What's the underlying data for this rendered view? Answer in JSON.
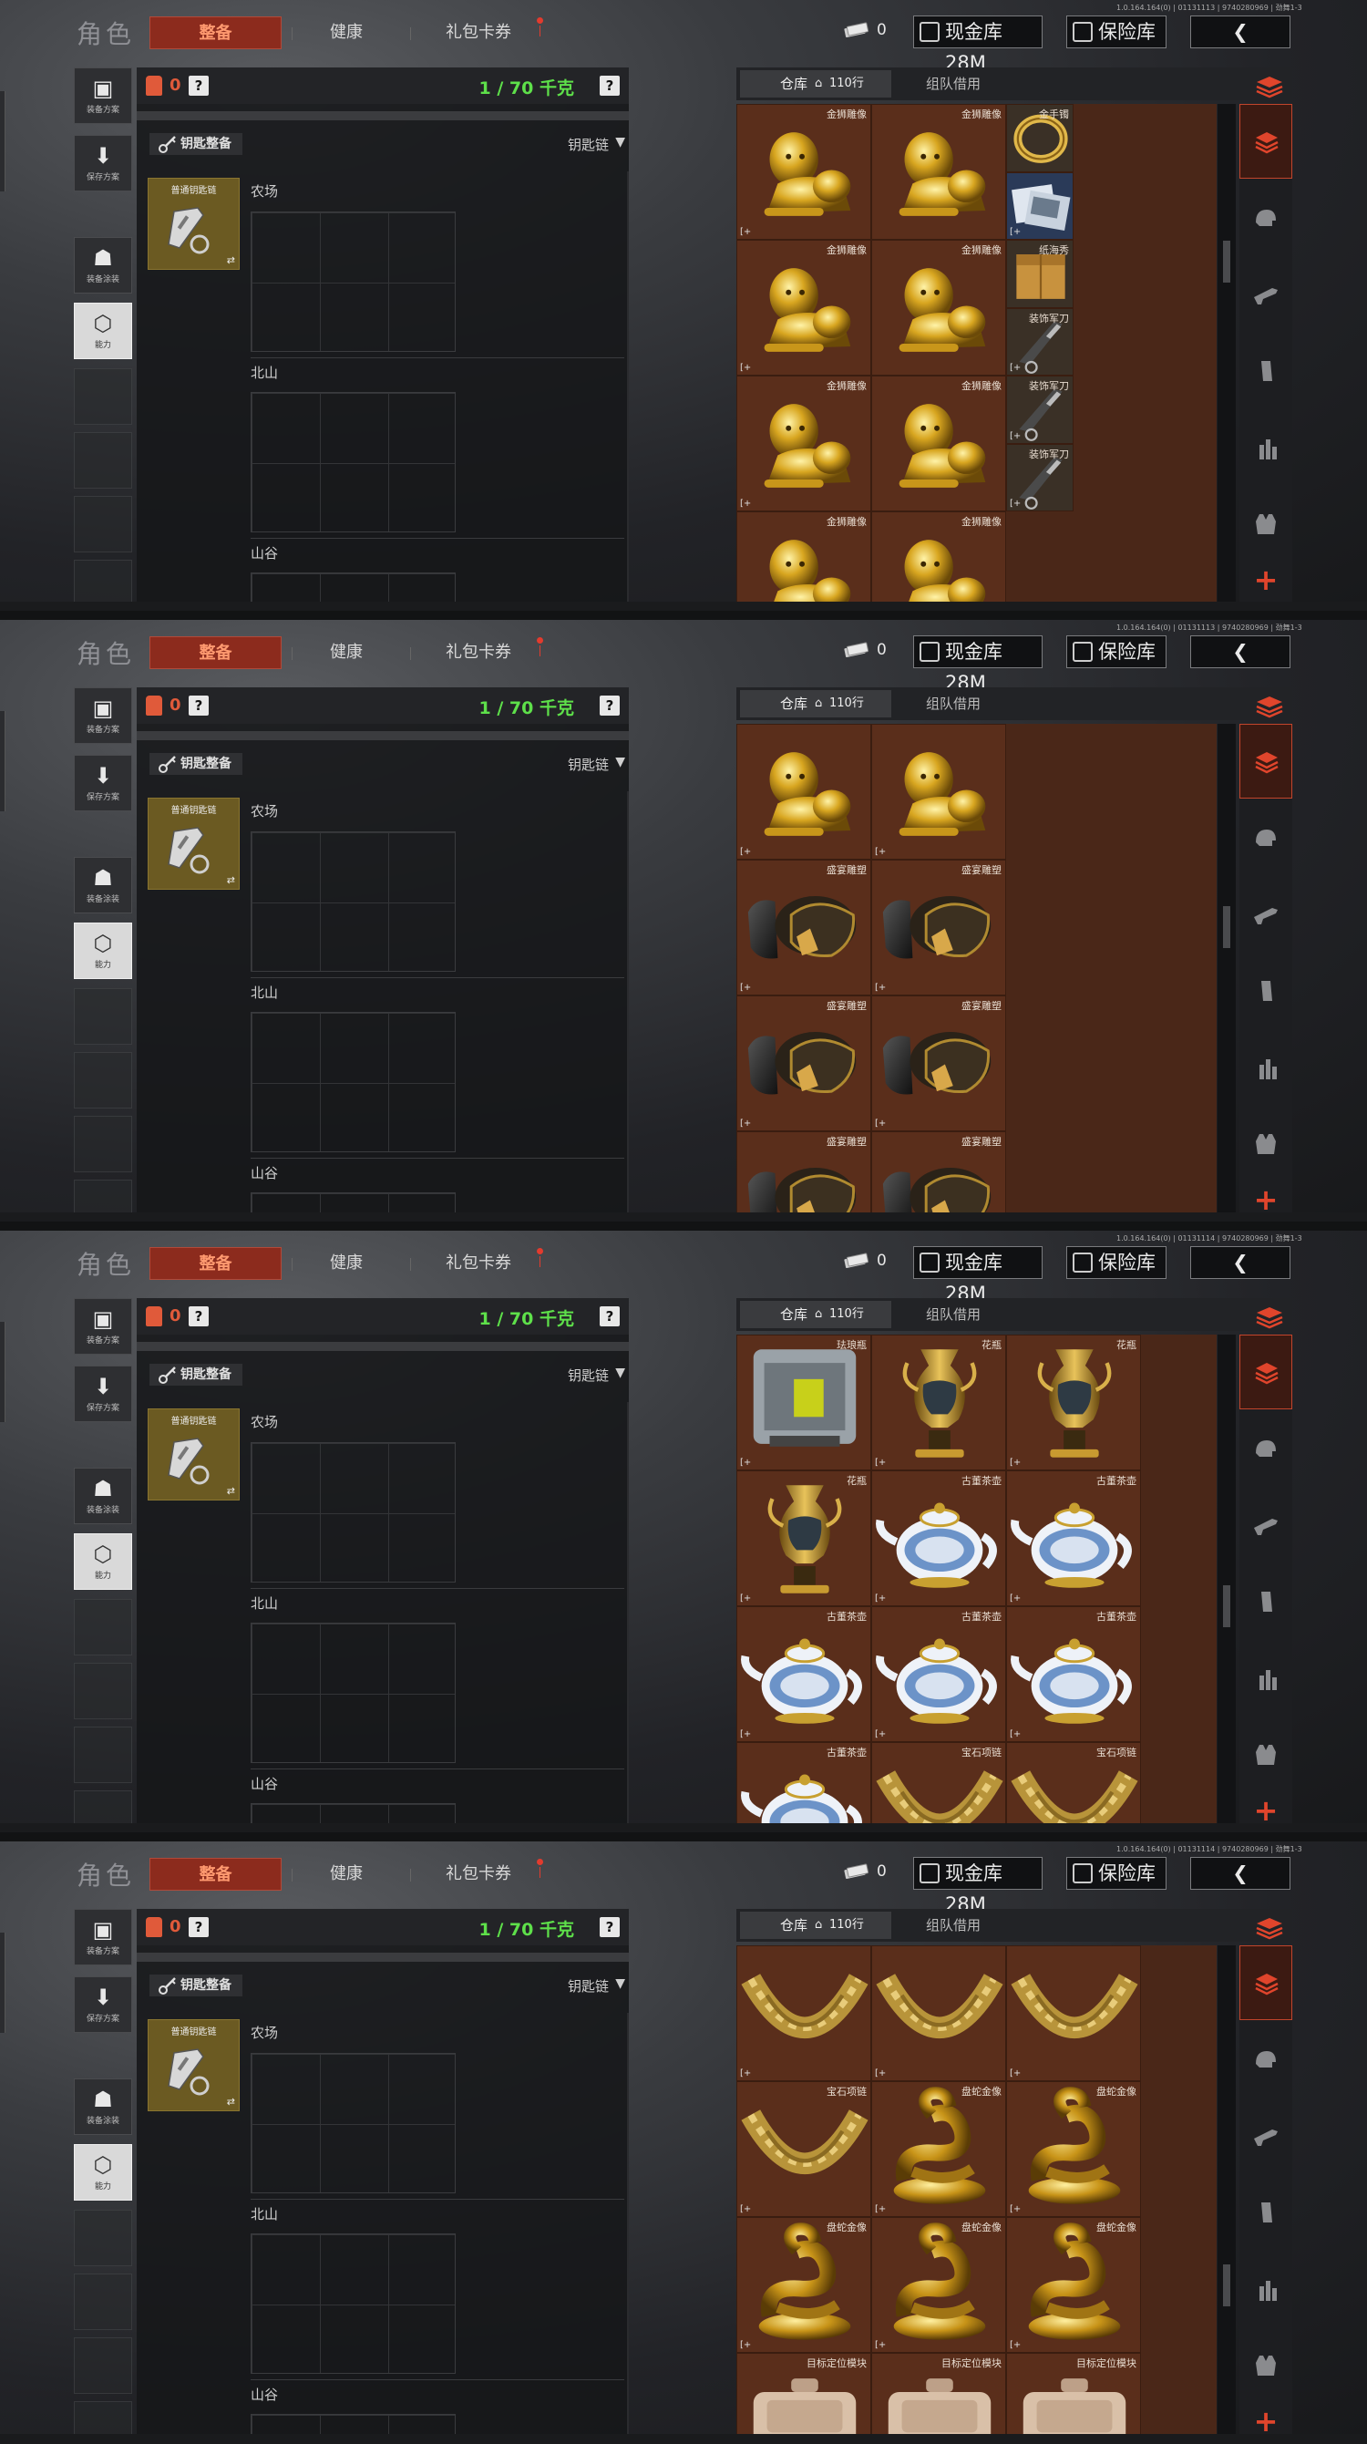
{
  "header": {
    "title": "角色",
    "tabs": [
      {
        "label": "整备",
        "active": true
      },
      {
        "label": "健康",
        "active": false
      },
      {
        "label": "礼包卡券",
        "active": false
      }
    ],
    "version": "1.0.164.164(0) | 01131113 | 9740280969 | 劲舞1-3",
    "cash_count": "0",
    "cash_vault_label": "现金库 28M",
    "safe_label": "保险库",
    "back_label": "❮"
  },
  "sidebar": {
    "items": [
      {
        "label": "装备方案"
      },
      {
        "label": "保存方案"
      },
      {
        "label": "装备涂装"
      },
      {
        "label": "能力"
      }
    ]
  },
  "loadout": {
    "bag_count": "0",
    "help": "?",
    "weight": "1 / 70 千克",
    "key_header": "钥匙整备",
    "key_chain_label": "钥匙链",
    "key_item": "普通钥匙链",
    "swap_icon": "⇄",
    "regions": [
      "农场",
      "北山",
      "山谷"
    ]
  },
  "warehouse": {
    "tab_label": "仓库",
    "rows_label": "110行",
    "team_tab": "组队借用",
    "add_label": "+",
    "corner_tag": "[+"
  },
  "shots": [
    {
      "version": "1.0.164.164(0) | 01131113 | 9740280969 | 劲舞1-3",
      "scroll_frac": 0.3,
      "items": [
        {
          "name": "金狮雕像",
          "type": "lion",
          "col": 0,
          "row": 0,
          "w": 1,
          "h": 1,
          "tag": true
        },
        {
          "name": "金狮雕像",
          "type": "lion",
          "col": 1,
          "row": 0,
          "w": 1,
          "h": 1,
          "tag": false
        },
        {
          "name": "金手镯",
          "type": "bracelet",
          "col": 2,
          "row": 0,
          "w": 0.5,
          "h": 0.5,
          "tag": false
        },
        {
          "name": "",
          "type": "photo",
          "col": 2,
          "row": 0.5,
          "w": 0.5,
          "h": 0.5,
          "tag": true
        },
        {
          "name": "金狮雕像",
          "type": "lion",
          "col": 0,
          "row": 1,
          "w": 1,
          "h": 1,
          "tag": true
        },
        {
          "name": "金狮雕像",
          "type": "lion",
          "col": 1,
          "row": 1,
          "w": 1,
          "h": 1,
          "tag": false
        },
        {
          "name": "纸海秀",
          "type": "crate",
          "col": 2,
          "row": 1,
          "w": 0.5,
          "h": 0.5,
          "tag": false
        },
        {
          "name": "装饰军刀",
          "type": "knife",
          "col": 2,
          "row": 1.5,
          "w": 0.5,
          "h": 0.5,
          "tag": true
        },
        {
          "name": "金狮雕像",
          "type": "lion",
          "col": 0,
          "row": 2,
          "w": 1,
          "h": 1,
          "tag": true
        },
        {
          "name": "金狮雕像",
          "type": "lion",
          "col": 1,
          "row": 2,
          "w": 1,
          "h": 1,
          "tag": false
        },
        {
          "name": "装饰军刀",
          "type": "knife",
          "col": 2,
          "row": 2,
          "w": 0.5,
          "h": 0.5,
          "tag": true
        },
        {
          "name": "装饰军刀",
          "type": "knife",
          "col": 2,
          "row": 2.5,
          "w": 0.5,
          "h": 0.5,
          "tag": true
        },
        {
          "name": "金狮雕像",
          "type": "lion",
          "col": 0,
          "row": 3,
          "w": 1,
          "h": 1,
          "tag": false
        },
        {
          "name": "金狮雕像",
          "type": "lion",
          "col": 1,
          "row": 3,
          "w": 1,
          "h": 1,
          "tag": false
        }
      ]
    },
    {
      "version": "1.0.164.164(0) | 01131113 | 9740280969 | 劲舞1-3",
      "scroll_frac": 0.4,
      "items": [
        {
          "name": "",
          "type": "lion",
          "col": 0,
          "row": 0,
          "w": 1,
          "h": 1,
          "tag": true
        },
        {
          "name": "",
          "type": "lion",
          "col": 1,
          "row": 0,
          "w": 1,
          "h": 1,
          "tag": true
        },
        {
          "name": "盛宴雕塑",
          "type": "sculpture",
          "col": 0,
          "row": 1,
          "w": 1,
          "h": 1,
          "tag": true
        },
        {
          "name": "盛宴雕塑",
          "type": "sculpture",
          "col": 1,
          "row": 1,
          "w": 1,
          "h": 1,
          "tag": true
        },
        {
          "name": "盛宴雕塑",
          "type": "sculpture",
          "col": 0,
          "row": 2,
          "w": 1,
          "h": 1,
          "tag": true
        },
        {
          "name": "盛宴雕塑",
          "type": "sculpture",
          "col": 1,
          "row": 2,
          "w": 1,
          "h": 1,
          "tag": true
        },
        {
          "name": "盛宴雕塑",
          "type": "sculpture",
          "col": 0,
          "row": 3,
          "w": 1,
          "h": 1,
          "tag": false
        },
        {
          "name": "盛宴雕塑",
          "type": "sculpture",
          "col": 1,
          "row": 3,
          "w": 1,
          "h": 1,
          "tag": false
        }
      ]
    },
    {
      "version": "1.0.164.164(0) | 01131114 | 9740280969 | 劲舞1-3",
      "scroll_frac": 0.55,
      "items": [
        {
          "name": "珐琅瓶",
          "type": "safe",
          "col": 0,
          "row": 0,
          "w": 1,
          "h": 1,
          "tag": true
        },
        {
          "name": "花瓶",
          "type": "vase",
          "col": 1,
          "row": 0,
          "w": 1,
          "h": 1,
          "tag": true
        },
        {
          "name": "花瓶",
          "type": "vase",
          "col": 2,
          "row": 0,
          "w": 1,
          "h": 1,
          "tag": true
        },
        {
          "name": "花瓶",
          "type": "vase",
          "col": 0,
          "row": 1,
          "w": 1,
          "h": 1,
          "tag": true
        },
        {
          "name": "古董茶壶",
          "type": "teapot",
          "col": 1,
          "row": 1,
          "w": 1,
          "h": 1,
          "tag": true
        },
        {
          "name": "古董茶壶",
          "type": "teapot",
          "col": 2,
          "row": 1,
          "w": 1,
          "h": 1,
          "tag": true
        },
        {
          "name": "古董茶壶",
          "type": "teapot",
          "col": 0,
          "row": 2,
          "w": 1,
          "h": 1,
          "tag": true
        },
        {
          "name": "古董茶壶",
          "type": "teapot",
          "col": 1,
          "row": 2,
          "w": 1,
          "h": 1,
          "tag": true
        },
        {
          "name": "古董茶壶",
          "type": "teapot",
          "col": 2,
          "row": 2,
          "w": 1,
          "h": 1,
          "tag": true
        },
        {
          "name": "古董茶壶",
          "type": "teapot",
          "col": 0,
          "row": 3,
          "w": 1,
          "h": 1,
          "tag": false
        },
        {
          "name": "宝石项链",
          "type": "necklace",
          "col": 1,
          "row": 3,
          "w": 1,
          "h": 1,
          "tag": false
        },
        {
          "name": "宝石项链",
          "type": "necklace",
          "col": 2,
          "row": 3,
          "w": 1,
          "h": 1,
          "tag": false
        }
      ]
    },
    {
      "version": "1.0.164.164(0) | 01131114 | 9740280969 | 劲舞1-3",
      "scroll_frac": 0.7,
      "items": [
        {
          "name": "",
          "type": "necklace",
          "col": 0,
          "row": 0,
          "w": 1,
          "h": 1,
          "tag": true
        },
        {
          "name": "",
          "type": "necklace",
          "col": 1,
          "row": 0,
          "w": 1,
          "h": 1,
          "tag": true
        },
        {
          "name": "",
          "type": "necklace",
          "col": 2,
          "row": 0,
          "w": 1,
          "h": 1,
          "tag": true
        },
        {
          "name": "宝石项链",
          "type": "necklace",
          "col": 0,
          "row": 1,
          "w": 1,
          "h": 1,
          "tag": true
        },
        {
          "name": "盘蛇金像",
          "type": "snake",
          "col": 1,
          "row": 1,
          "w": 1,
          "h": 1,
          "tag": true
        },
        {
          "name": "盘蛇金像",
          "type": "snake",
          "col": 2,
          "row": 1,
          "w": 1,
          "h": 1,
          "tag": true
        },
        {
          "name": "盘蛇金像",
          "type": "snake",
          "col": 0,
          "row": 2,
          "w": 1,
          "h": 1,
          "tag": true
        },
        {
          "name": "盘蛇金像",
          "type": "snake",
          "col": 1,
          "row": 2,
          "w": 1,
          "h": 1,
          "tag": true
        },
        {
          "name": "盘蛇金像",
          "type": "snake",
          "col": 2,
          "row": 2,
          "w": 1,
          "h": 1,
          "tag": true
        },
        {
          "name": "目标定位模块",
          "type": "device",
          "col": 0,
          "row": 3,
          "w": 1,
          "h": 1,
          "tag": false
        },
        {
          "name": "目标定位模块",
          "type": "device",
          "col": 1,
          "row": 3,
          "w": 1,
          "h": 1,
          "tag": false
        },
        {
          "name": "目标定位模块",
          "type": "device",
          "col": 2,
          "row": 3,
          "w": 1,
          "h": 1,
          "tag": false
        }
      ]
    }
  ],
  "categories": [
    {
      "icon": "layers-icon",
      "active": true
    },
    {
      "icon": "helmet-icon",
      "active": false
    },
    {
      "icon": "rifle-icon",
      "active": false
    },
    {
      "icon": "magazine-icon",
      "active": false
    },
    {
      "icon": "bullet-icon",
      "active": false
    },
    {
      "icon": "vest-icon",
      "active": false
    }
  ],
  "colors": {
    "accent": "#c2452c",
    "weight_green": "#5ee04a",
    "grid_bg": "#4a2718"
  }
}
